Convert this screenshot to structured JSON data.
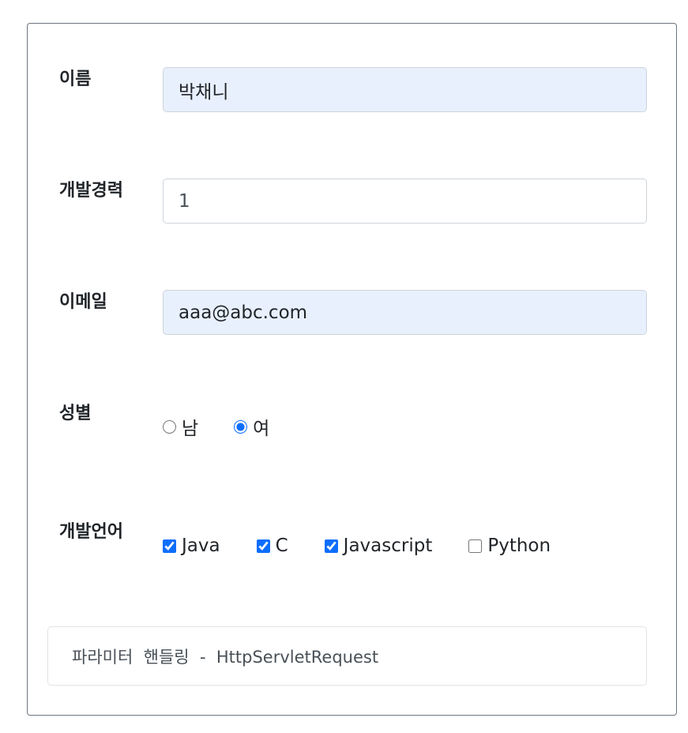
{
  "form": {
    "name": {
      "label": "이름",
      "value": "박채니"
    },
    "career": {
      "label": "개발경력",
      "value": "1"
    },
    "email": {
      "label": "이메일",
      "value": "aaa@abc.com"
    },
    "gender": {
      "label": "성별",
      "options": [
        {
          "label": "남",
          "checked": false
        },
        {
          "label": "여",
          "checked": true
        }
      ]
    },
    "languages": {
      "label": "개발언어",
      "options": [
        {
          "label": "Java",
          "checked": true
        },
        {
          "label": "C",
          "checked": true
        },
        {
          "label": "Javascript",
          "checked": true
        },
        {
          "label": "Python",
          "checked": false
        }
      ]
    }
  },
  "footer": {
    "text": "파라미터  핸들링  -  HttpServletRequest"
  },
  "colors": {
    "accent": "#0d6efd",
    "autofill": "#e8f0fe",
    "card_border": "#6c757d"
  }
}
